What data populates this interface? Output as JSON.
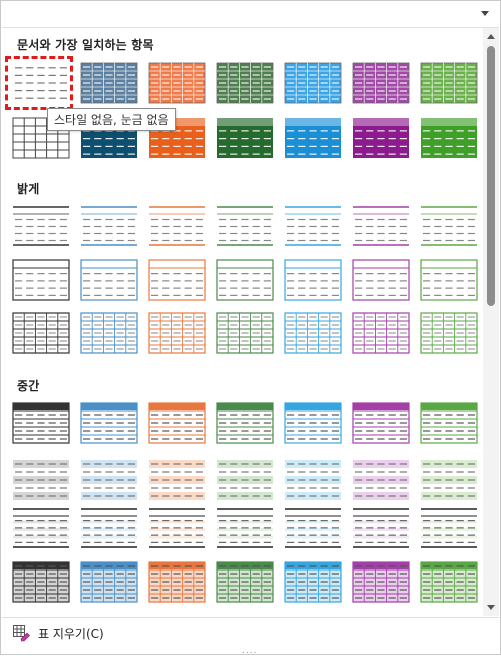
{
  "sections": [
    {
      "id": "match",
      "title": "문서와 가장 일치하는 항목",
      "kind": "match",
      "rows": 2
    },
    {
      "id": "light",
      "title": "밝게",
      "kind": "light",
      "rows": 3
    },
    {
      "id": "medium",
      "title": "중간",
      "kind": "medium",
      "rows": 4
    }
  ],
  "colors": {
    "match_row1": [
      "#ffffff",
      "#5b7fa0",
      "#f07a4a",
      "#4f7f4f",
      "#3aa4e6",
      "#a04aa6",
      "#6ab04c"
    ],
    "match_row2": [
      "#ffffff",
      "#0d4f6e",
      "#e8601c",
      "#256b2e",
      "#1b8fd6",
      "#8c1b8e",
      "#3f9f29"
    ],
    "accents": [
      "#333333",
      "#4a8fc7",
      "#e8773f",
      "#4a8a4a",
      "#36a6e0",
      "#a23fa8",
      "#5aa845"
    ],
    "medium_bands": [
      "#d5d5d5",
      "#cfe3f3",
      "#fbd9c7",
      "#d3e6d0",
      "#cdeaf8",
      "#ead0ec",
      "#d9eccf"
    ]
  },
  "tooltip": {
    "text": "스타일 없음, 눈금 없음"
  },
  "footer": {
    "clear_label": "표 지우기(C)"
  },
  "grip": "....",
  "icons": {
    "dropdown": "chevron-down-icon",
    "clear": "table-eraser-icon",
    "scroll_up": "arrow-up-icon",
    "scroll_down": "arrow-down-icon"
  }
}
